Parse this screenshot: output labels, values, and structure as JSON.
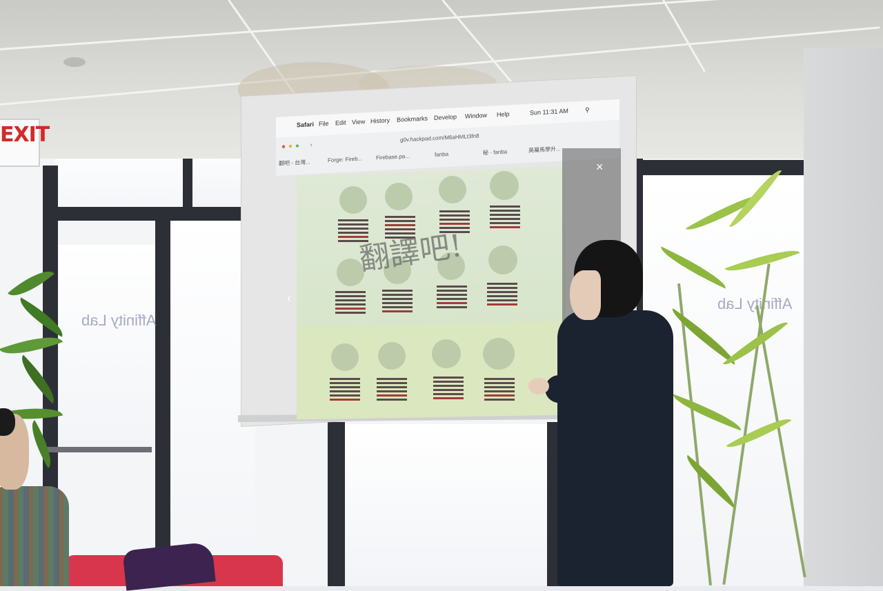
{
  "scene": {
    "exit_sign": "EXIT",
    "glass_lettering_left": "Affinity Lab",
    "glass_lettering_right": "Affinity Lab"
  },
  "projection": {
    "menubar": {
      "apple": "",
      "items": [
        "Safari",
        "File",
        "Edit",
        "View",
        "History",
        "Bookmarks",
        "Develop",
        "Window",
        "Help"
      ],
      "clock": "Sun 11:31 AM"
    },
    "url": "g0v.hackpad.com/M6aHMLt3fn8",
    "tabs": [
      "翻吧 - 台灣...",
      "Forge: Fireb...",
      "Firebase.pa...",
      "fanba",
      "秘 · fanba",
      "英屬馬學升..."
    ],
    "handwriting": "翻譯吧!",
    "close_glyph": "×",
    "prev_glyph": "‹",
    "colors": {
      "canvas": "#d6e5c9",
      "hexagram_line": "#5a4b4b",
      "accent_red": "#a43a3a"
    }
  }
}
